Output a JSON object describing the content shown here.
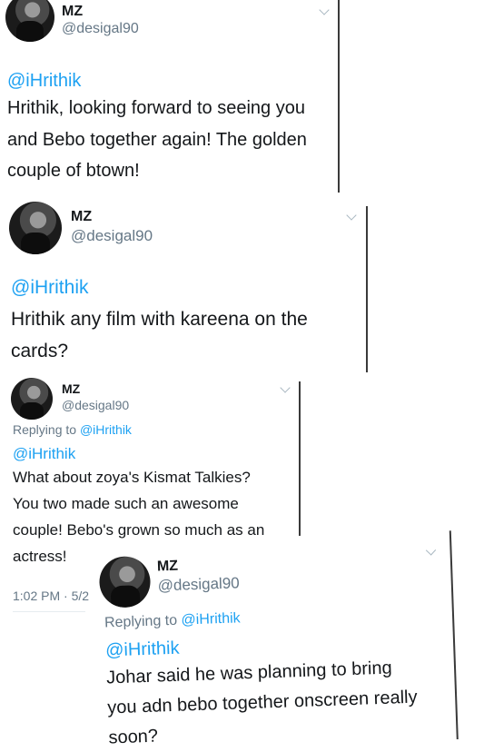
{
  "tweets": [
    {
      "name": "MZ",
      "handle": "@desigal90",
      "mention": "@iHrithik",
      "lines": [
        "Hrithik, looking forward to seeing you",
        "and Bebo together again! The golden",
        "couple of btown!"
      ]
    },
    {
      "name": "MZ",
      "handle": "@desigal90",
      "mention": "@iHrithik",
      "lines": [
        "Hrithik any film with kareena on the",
        "cards?"
      ]
    },
    {
      "name": "MZ",
      "handle": "@desigal90",
      "replying_prefix": "Replying to ",
      "replying_to": "@iHrithik",
      "mention": "@iHrithik",
      "lines": [
        "What about zoya's Kismat Talkies?",
        "You two made such an awesome",
        "couple! Bebo's grown so much as an",
        "actress!"
      ],
      "timestamp": "1:02 PM · 5/2"
    },
    {
      "name": "MZ",
      "handle": "@desigal90",
      "replying_prefix": "Replying to ",
      "replying_to": "@iHrithik",
      "mention": "@iHrithik",
      "lines": [
        "Johar said he was planning to bring",
        "you adn bebo together onscreen really",
        "soon?"
      ]
    }
  ],
  "icons": {
    "chevron": "chevron-down-icon",
    "avatar": "profile-avatar"
  },
  "colors": {
    "link": "#1da1f2",
    "secondary": "#657786",
    "text": "#14171a"
  }
}
